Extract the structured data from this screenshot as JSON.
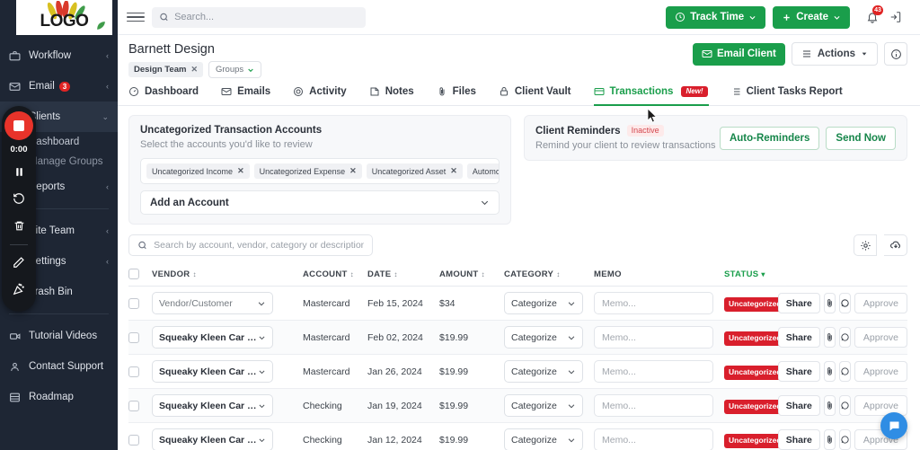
{
  "sidebar": {
    "logo": {
      "text": "LOGO"
    },
    "items": [
      {
        "label": "Workflow",
        "icon": "briefcase-icon",
        "chevron": "‹",
        "badge": null,
        "active": false
      },
      {
        "label": "Email",
        "icon": "envelope-icon",
        "chevron": "‹",
        "badge": "3",
        "active": false
      },
      {
        "label": "Clients",
        "icon": "users-icon",
        "chevron": "⌄",
        "badge": null,
        "active": true
      }
    ],
    "sub_items": [
      {
        "label": "Dashboard"
      },
      {
        "label": "Manage Groups"
      }
    ],
    "items_lower": [
      {
        "label": "Reports",
        "icon": "chart-icon",
        "chevron": "‹"
      },
      {
        "label": "Site Team",
        "icon": "team-icon",
        "chevron": "‹"
      },
      {
        "label": "Settings",
        "icon": "gear-icon",
        "chevron": "‹"
      },
      {
        "label": "Trash Bin",
        "icon": "trash-icon",
        "chevron": ""
      }
    ],
    "items_bottom": [
      {
        "label": "Tutorial Videos",
        "icon": "video-icon"
      },
      {
        "label": "Contact Support",
        "icon": "person-icon"
      },
      {
        "label": "Roadmap",
        "icon": "roadmap-icon"
      }
    ]
  },
  "recorder": {
    "timer": "0:00",
    "buttons": [
      "stop-recording",
      "pause",
      "restart",
      "delete",
      "pencil",
      "effects"
    ]
  },
  "topbar": {
    "search_placeholder": "Search...",
    "search_value": "",
    "track_time_label": "Track Time",
    "create_label": "Create",
    "notification_count": "43"
  },
  "client": {
    "name": "Barnett Design",
    "group_chip": "Design Team",
    "groups_dropdown": "Groups",
    "email_client_label": "Email Client",
    "actions_label": "Actions"
  },
  "tabs": [
    {
      "label": "Dashboard",
      "icon": "dashboard-icon",
      "active": false,
      "badge": null
    },
    {
      "label": "Emails",
      "icon": "envelope-icon",
      "active": false,
      "badge": null
    },
    {
      "label": "Activity",
      "icon": "activity-icon",
      "active": false,
      "badge": null
    },
    {
      "label": "Notes",
      "icon": "notes-icon",
      "active": false,
      "badge": null
    },
    {
      "label": "Files",
      "icon": "paperclip-icon",
      "active": false,
      "badge": null
    },
    {
      "label": "Client Vault",
      "icon": "lock-icon",
      "active": false,
      "badge": null
    },
    {
      "label": "Transactions",
      "icon": "card-icon",
      "active": true,
      "badge": "New!"
    },
    {
      "label": "Client Tasks Report",
      "icon": "list-icon",
      "active": false,
      "badge": null
    }
  ],
  "uncategorized_panel": {
    "title": "Uncategorized Transaction Accounts",
    "subtitle": "Select the accounts you'd like to review",
    "accounts": [
      "Uncategorized Income",
      "Uncategorized Expense",
      "Uncategorized Asset",
      "Automobile"
    ],
    "add_account_label": "Add an Account"
  },
  "reminders_panel": {
    "title": "Client Reminders",
    "status_badge": "Inactive",
    "subtitle": "Remind your client to review transactions",
    "auto_reminders_label": "Auto-Reminders",
    "send_now_label": "Send Now"
  },
  "table": {
    "search_placeholder": "Search by account, vendor, category or description",
    "search_value": "",
    "columns": [
      {
        "label": "VENDOR",
        "sortable": true
      },
      {
        "label": "ACCOUNT",
        "sortable": true
      },
      {
        "label": "DATE",
        "sortable": true
      },
      {
        "label": "AMOUNT",
        "sortable": true
      },
      {
        "label": "CATEGORY",
        "sortable": true
      },
      {
        "label": "MEMO",
        "sortable": false
      },
      {
        "label": "STATUS",
        "sortable": true,
        "active_sort": true
      }
    ],
    "memo_placeholder": "Memo...",
    "categorize_label": "Categorize",
    "share_label": "Share",
    "approve_label": "Approve",
    "rows": [
      {
        "vendor": "Vendor/Customer",
        "vendor_is_placeholder": true,
        "account": "Mastercard",
        "date": "Feb 15, 2024",
        "amount": "$34",
        "memo": "",
        "status": "Uncategorized"
      },
      {
        "vendor": "Squeaky Kleen Car Wa...",
        "vendor_is_placeholder": false,
        "account": "Mastercard",
        "date": "Feb 02, 2024",
        "amount": "$19.99",
        "memo": "",
        "status": "Uncategorized"
      },
      {
        "vendor": "Squeaky Kleen Car Wa...",
        "vendor_is_placeholder": false,
        "account": "Mastercard",
        "date": "Jan 26, 2024",
        "amount": "$19.99",
        "memo": "",
        "status": "Uncategorized"
      },
      {
        "vendor": "Squeaky Kleen Car Wa...",
        "vendor_is_placeholder": false,
        "account": "Checking",
        "date": "Jan 19, 2024",
        "amount": "$19.99",
        "memo": "",
        "status": "Uncategorized"
      },
      {
        "vendor": "Squeaky Kleen Car Wa...",
        "vendor_is_placeholder": false,
        "account": "Checking",
        "date": "Jan 12, 2024",
        "amount": "$19.99",
        "memo": "",
        "status": "Uncategorized"
      }
    ]
  },
  "colors": {
    "brand_green": "#1a9e4b",
    "danger_red": "#d91f2c",
    "sidebar_bg": "#1e2634",
    "chat_blue": "#2f8de4"
  }
}
